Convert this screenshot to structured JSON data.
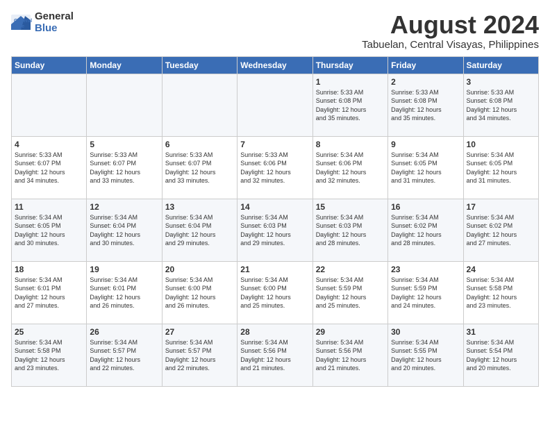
{
  "logo": {
    "line1": "General",
    "line2": "Blue"
  },
  "title": "August 2024",
  "location": "Tabuelan, Central Visayas, Philippines",
  "days_of_week": [
    "Sunday",
    "Monday",
    "Tuesday",
    "Wednesday",
    "Thursday",
    "Friday",
    "Saturday"
  ],
  "weeks": [
    [
      {
        "day": "",
        "info": ""
      },
      {
        "day": "",
        "info": ""
      },
      {
        "day": "",
        "info": ""
      },
      {
        "day": "",
        "info": ""
      },
      {
        "day": "1",
        "info": "Sunrise: 5:33 AM\nSunset: 6:08 PM\nDaylight: 12 hours\nand 35 minutes."
      },
      {
        "day": "2",
        "info": "Sunrise: 5:33 AM\nSunset: 6:08 PM\nDaylight: 12 hours\nand 35 minutes."
      },
      {
        "day": "3",
        "info": "Sunrise: 5:33 AM\nSunset: 6:08 PM\nDaylight: 12 hours\nand 34 minutes."
      }
    ],
    [
      {
        "day": "4",
        "info": "Sunrise: 5:33 AM\nSunset: 6:07 PM\nDaylight: 12 hours\nand 34 minutes."
      },
      {
        "day": "5",
        "info": "Sunrise: 5:33 AM\nSunset: 6:07 PM\nDaylight: 12 hours\nand 33 minutes."
      },
      {
        "day": "6",
        "info": "Sunrise: 5:33 AM\nSunset: 6:07 PM\nDaylight: 12 hours\nand 33 minutes."
      },
      {
        "day": "7",
        "info": "Sunrise: 5:33 AM\nSunset: 6:06 PM\nDaylight: 12 hours\nand 32 minutes."
      },
      {
        "day": "8",
        "info": "Sunrise: 5:34 AM\nSunset: 6:06 PM\nDaylight: 12 hours\nand 32 minutes."
      },
      {
        "day": "9",
        "info": "Sunrise: 5:34 AM\nSunset: 6:05 PM\nDaylight: 12 hours\nand 31 minutes."
      },
      {
        "day": "10",
        "info": "Sunrise: 5:34 AM\nSunset: 6:05 PM\nDaylight: 12 hours\nand 31 minutes."
      }
    ],
    [
      {
        "day": "11",
        "info": "Sunrise: 5:34 AM\nSunset: 6:05 PM\nDaylight: 12 hours\nand 30 minutes."
      },
      {
        "day": "12",
        "info": "Sunrise: 5:34 AM\nSunset: 6:04 PM\nDaylight: 12 hours\nand 30 minutes."
      },
      {
        "day": "13",
        "info": "Sunrise: 5:34 AM\nSunset: 6:04 PM\nDaylight: 12 hours\nand 29 minutes."
      },
      {
        "day": "14",
        "info": "Sunrise: 5:34 AM\nSunset: 6:03 PM\nDaylight: 12 hours\nand 29 minutes."
      },
      {
        "day": "15",
        "info": "Sunrise: 5:34 AM\nSunset: 6:03 PM\nDaylight: 12 hours\nand 28 minutes."
      },
      {
        "day": "16",
        "info": "Sunrise: 5:34 AM\nSunset: 6:02 PM\nDaylight: 12 hours\nand 28 minutes."
      },
      {
        "day": "17",
        "info": "Sunrise: 5:34 AM\nSunset: 6:02 PM\nDaylight: 12 hours\nand 27 minutes."
      }
    ],
    [
      {
        "day": "18",
        "info": "Sunrise: 5:34 AM\nSunset: 6:01 PM\nDaylight: 12 hours\nand 27 minutes."
      },
      {
        "day": "19",
        "info": "Sunrise: 5:34 AM\nSunset: 6:01 PM\nDaylight: 12 hours\nand 26 minutes."
      },
      {
        "day": "20",
        "info": "Sunrise: 5:34 AM\nSunset: 6:00 PM\nDaylight: 12 hours\nand 26 minutes."
      },
      {
        "day": "21",
        "info": "Sunrise: 5:34 AM\nSunset: 6:00 PM\nDaylight: 12 hours\nand 25 minutes."
      },
      {
        "day": "22",
        "info": "Sunrise: 5:34 AM\nSunset: 5:59 PM\nDaylight: 12 hours\nand 25 minutes."
      },
      {
        "day": "23",
        "info": "Sunrise: 5:34 AM\nSunset: 5:59 PM\nDaylight: 12 hours\nand 24 minutes."
      },
      {
        "day": "24",
        "info": "Sunrise: 5:34 AM\nSunset: 5:58 PM\nDaylight: 12 hours\nand 23 minutes."
      }
    ],
    [
      {
        "day": "25",
        "info": "Sunrise: 5:34 AM\nSunset: 5:58 PM\nDaylight: 12 hours\nand 23 minutes."
      },
      {
        "day": "26",
        "info": "Sunrise: 5:34 AM\nSunset: 5:57 PM\nDaylight: 12 hours\nand 22 minutes."
      },
      {
        "day": "27",
        "info": "Sunrise: 5:34 AM\nSunset: 5:57 PM\nDaylight: 12 hours\nand 22 minutes."
      },
      {
        "day": "28",
        "info": "Sunrise: 5:34 AM\nSunset: 5:56 PM\nDaylight: 12 hours\nand 21 minutes."
      },
      {
        "day": "29",
        "info": "Sunrise: 5:34 AM\nSunset: 5:56 PM\nDaylight: 12 hours\nand 21 minutes."
      },
      {
        "day": "30",
        "info": "Sunrise: 5:34 AM\nSunset: 5:55 PM\nDaylight: 12 hours\nand 20 minutes."
      },
      {
        "day": "31",
        "info": "Sunrise: 5:34 AM\nSunset: 5:54 PM\nDaylight: 12 hours\nand 20 minutes."
      }
    ]
  ]
}
